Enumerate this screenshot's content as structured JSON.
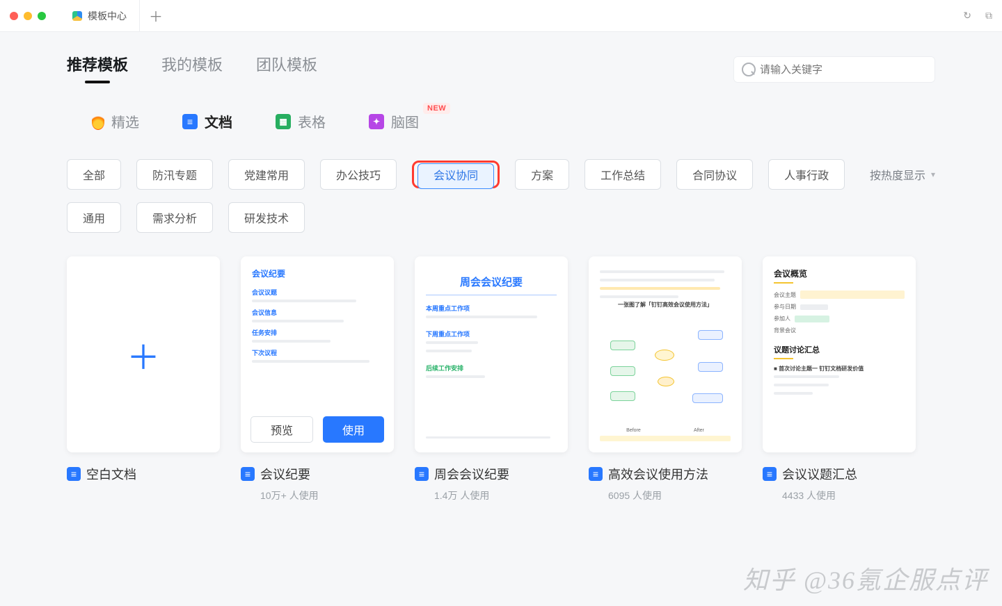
{
  "window": {
    "tab_title": "模板中心"
  },
  "main_nav": [
    {
      "label": "推荐模板",
      "active": true
    },
    {
      "label": "我的模板",
      "active": false
    },
    {
      "label": "团队模板",
      "active": false
    }
  ],
  "search": {
    "placeholder": "请输入关键字"
  },
  "type_tabs": {
    "featured": "精选",
    "doc": "文档",
    "sheet": "表格",
    "mindmap": "脑图",
    "new_badge": "NEW"
  },
  "filters": {
    "row1": [
      {
        "label": "全部"
      },
      {
        "label": "防汛专题"
      },
      {
        "label": "党建常用"
      },
      {
        "label": "办公技巧"
      },
      {
        "label": "会议协同",
        "active": true,
        "highlight": true
      },
      {
        "label": "方案"
      },
      {
        "label": "工作总结"
      },
      {
        "label": "合同协议"
      },
      {
        "label": "人事行政"
      }
    ],
    "row2": [
      {
        "label": "通用"
      },
      {
        "label": "需求分析"
      },
      {
        "label": "研发技术"
      }
    ],
    "sort_label": "按热度显示"
  },
  "actions": {
    "preview": "预览",
    "use": "使用"
  },
  "templates": [
    {
      "name": "空白文档",
      "blank": true
    },
    {
      "name": "会议纪要",
      "meta": "10万+ 人使用",
      "hovered": true,
      "preview": {
        "style": "outline",
        "title": "会议纪要",
        "sections": [
          "会议议题",
          "会议信息",
          "任务安排",
          "下次议程"
        ]
      }
    },
    {
      "name": "周会会议纪要",
      "meta": "1.4万 人使用",
      "preview": {
        "style": "centered",
        "title": "周会会议纪要",
        "sections": [
          "本周重点工作项",
          "下周重点工作项",
          "后续工作安排"
        ]
      }
    },
    {
      "name": "高效会议使用方法",
      "meta": "6095 人使用",
      "preview": {
        "style": "mindmap",
        "title": "一张图了解「钉钉高效会议使用方法」",
        "compare_labels": [
          "Before",
          "After"
        ]
      }
    },
    {
      "name": "会议议题汇总",
      "meta": "4433 人使用",
      "preview": {
        "style": "yellow",
        "title": "会议概览",
        "fields": [
          "会议主题",
          "参与日期",
          "参加人",
          "背景会议"
        ],
        "section2": "议题讨论汇总",
        "bullet": "首次讨论主题一 钉钉文档研发价值"
      }
    }
  ],
  "watermark": "知乎 @36氪企服点评"
}
